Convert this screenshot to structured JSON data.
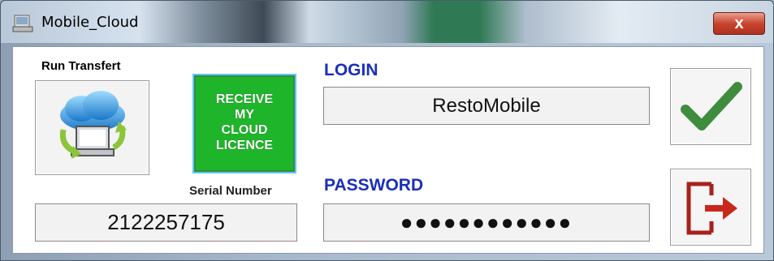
{
  "window": {
    "title": "Mobile_Cloud",
    "close_label": "x"
  },
  "run_transfer": {
    "label": "Run Transfert",
    "icon": "cloud-sync-icon"
  },
  "licence_button": {
    "lines": [
      "RECEIVE",
      "MY",
      "CLOUD",
      "LICENCE"
    ],
    "color": "#1fb52b"
  },
  "serial": {
    "label": "Serial Number",
    "value": "2122257175"
  },
  "login": {
    "label": "LOGIN",
    "value": "RestoMobile"
  },
  "password": {
    "label": "PASSWORD",
    "masked_value": "●●●●●●●●●●●●"
  },
  "actions": {
    "ok_icon": "checkmark-icon",
    "exit_icon": "exit-door-icon"
  },
  "colors": {
    "accent_label": "#1a2fb8",
    "licence_green": "#1fb52b",
    "check_green": "#3f8c3f",
    "exit_red": "#a8201a"
  }
}
